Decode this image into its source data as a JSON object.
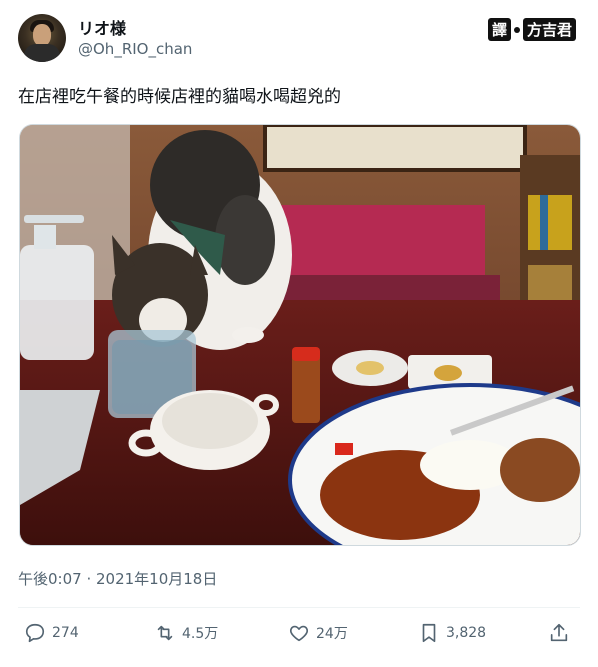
{
  "user": {
    "display_name": "リオ様",
    "handle": "@Oh_RIO_chan"
  },
  "watermark": {
    "left": "譯",
    "right": "方吉君"
  },
  "tweet": {
    "text": "在店裡吃午餐的時候店裡的貓喝水喝超兇的",
    "timestamp": "午後0:07 · 2021年10月18日"
  },
  "actions": {
    "replies": "274",
    "retweets": "4.5万",
    "likes": "24万",
    "bookmarks": "3,828"
  },
  "colors": {
    "text": "#0f1419",
    "secondary": "#536471",
    "divider": "#eff3f4"
  }
}
